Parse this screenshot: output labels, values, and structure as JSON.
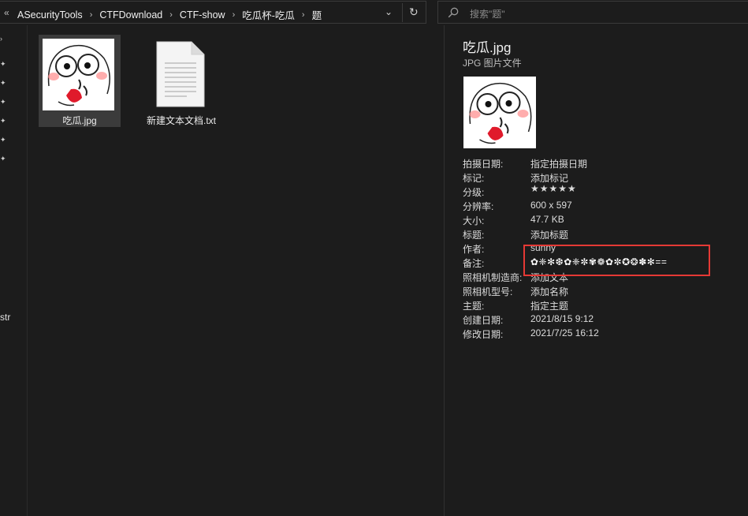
{
  "address_bar": {
    "overflow_chevron": "«",
    "breadcrumbs": [
      "ASecurityTools",
      "CTFDownload",
      "CTF-show",
      "吃瓜杯-吃瓜",
      "题"
    ],
    "separator": "›",
    "dropdown": "⌄",
    "refresh": "↻"
  },
  "search": {
    "placeholder": "搜索\"题\"",
    "icon": "search-icon"
  },
  "nav": {
    "partial_text": "str",
    "pin_icons": 6,
    "pin": "📌",
    "chevron": "›"
  },
  "files": [
    {
      "name": "吃瓜.jpg",
      "type": "image",
      "selected": true
    },
    {
      "name": "新建文本文档.txt",
      "type": "text-document",
      "selected": false
    }
  ],
  "details": {
    "title": "吃瓜.jpg",
    "type": "JPG 图片文件",
    "properties": [
      {
        "key": "拍摄日期:",
        "value": "指定拍摄日期"
      },
      {
        "key": "标记:",
        "value": "添加标记"
      },
      {
        "key": "分级:",
        "value": "★★★★★",
        "rating": 0
      },
      {
        "key": "分辨率:",
        "value": "600 x 597"
      },
      {
        "key": "大小:",
        "value": "47.7 KB"
      },
      {
        "key": "标题:",
        "value": "添加标题"
      },
      {
        "key": "作者:",
        "value": "sunny"
      },
      {
        "key": "备注:",
        "value": "✿❈✻❆✿❈✼✾❁✿✼✪❂✽✻=="
      },
      {
        "key": "照相机制造商:",
        "value": "添加文本"
      },
      {
        "key": "照相机型号:",
        "value": "添加名称"
      },
      {
        "key": "主题:",
        "value": "指定主题"
      },
      {
        "key": "创建日期:",
        "value": "2021/8/15 9:12"
      },
      {
        "key": "修改日期:",
        "value": "2021/7/25 16:12"
      }
    ]
  },
  "colors": {
    "background": "#1c1c1c",
    "selection": "#3b3b3b",
    "highlight_box": "#e53935"
  }
}
